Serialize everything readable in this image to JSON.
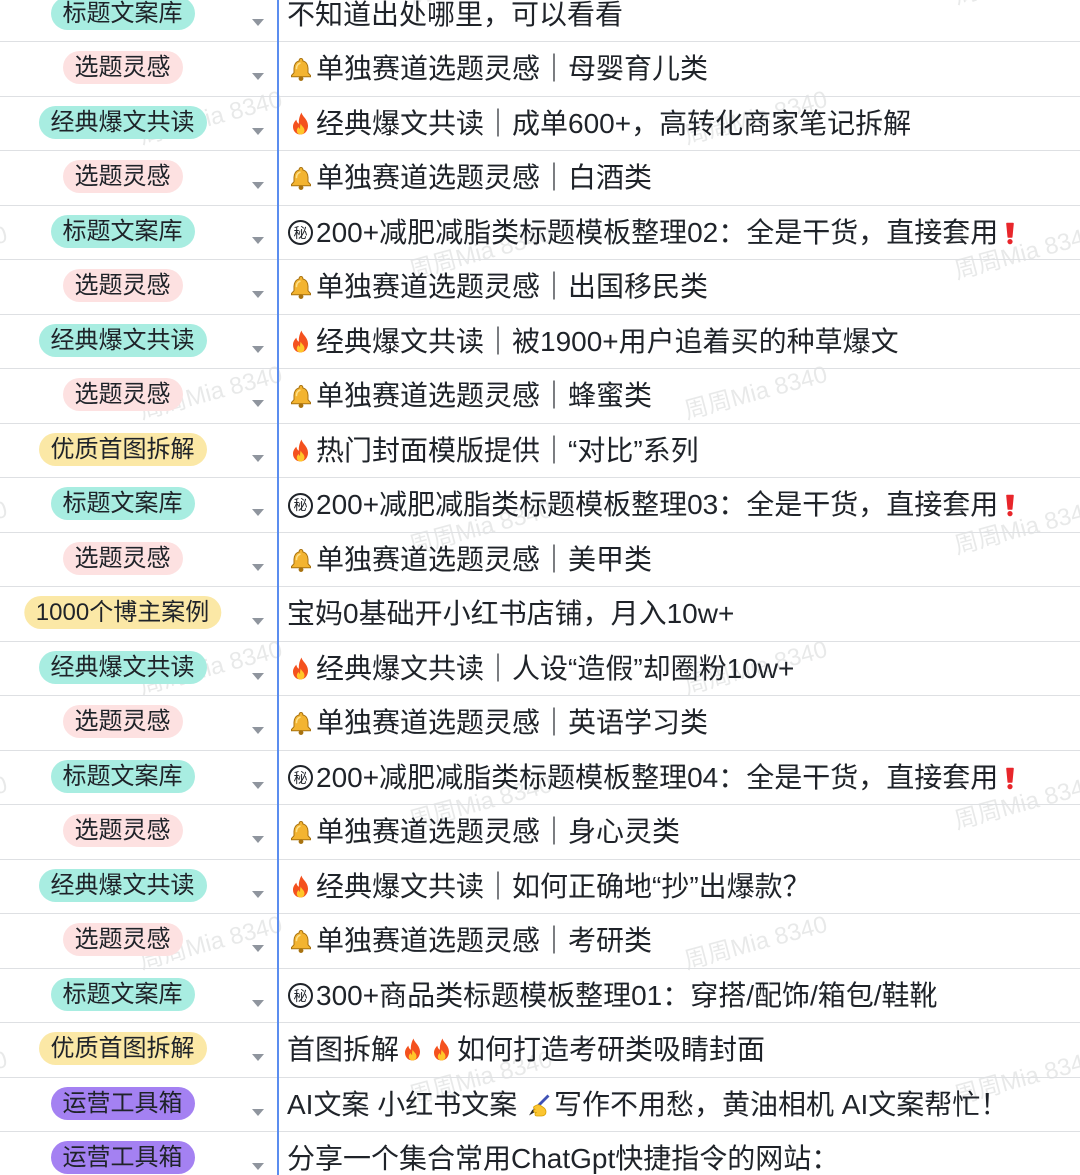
{
  "colors": {
    "text": "#1f2329",
    "row_border": "#dee0e3",
    "column_divider": "#5b8def",
    "arrow": "#8f959e",
    "watermark": "rgba(31,35,41,0.10)"
  },
  "tag_colors": {
    "标题文案库": "#a8ede1",
    "选题灵感": "#fde1e1",
    "经典爆文共读": "#a8ede1",
    "优质首图拆解": "#fbe8a6",
    "1000个博主案例": "#fbe8a6",
    "运营工具箱": "#a481f2"
  },
  "icon_glyphs": {
    "secret": "秘"
  },
  "watermark": {
    "text": "周周Mia 8340"
  },
  "table": {
    "rows": [
      {
        "tag": "标题文案库",
        "segments": [
          {
            "text": "不知道出处哪里，可以看看"
          }
        ]
      },
      {
        "tag": "选题灵感",
        "segments": [
          {
            "icon": "bell-icon"
          },
          {
            "text": "单独赛道选题灵感｜母婴育儿类"
          }
        ]
      },
      {
        "tag": "经典爆文共读",
        "segments": [
          {
            "icon": "fire-icon"
          },
          {
            "text": "经典爆文共读｜成单600+，高转化商家笔记拆解"
          }
        ]
      },
      {
        "tag": "选题灵感",
        "segments": [
          {
            "icon": "bell-icon"
          },
          {
            "text": "单独赛道选题灵感｜白酒类"
          }
        ]
      },
      {
        "tag": "标题文案库",
        "segments": [
          {
            "icon": "secret-icon"
          },
          {
            "text": "200+减肥减脂类标题模板整理02：全是干货，直接套用"
          },
          {
            "icon": "exclamation-icon"
          }
        ]
      },
      {
        "tag": "选题灵感",
        "segments": [
          {
            "icon": "bell-icon"
          },
          {
            "text": "单独赛道选题灵感｜出国移民类"
          }
        ]
      },
      {
        "tag": "经典爆文共读",
        "segments": [
          {
            "icon": "fire-icon"
          },
          {
            "text": "经典爆文共读｜被1900+用户追着买的种草爆文"
          }
        ]
      },
      {
        "tag": "选题灵感",
        "segments": [
          {
            "icon": "bell-icon"
          },
          {
            "text": "单独赛道选题灵感｜蜂蜜类"
          }
        ]
      },
      {
        "tag": "优质首图拆解",
        "segments": [
          {
            "icon": "fire-icon"
          },
          {
            "text": "热门封面模版提供｜“对比”系列"
          }
        ]
      },
      {
        "tag": "标题文案库",
        "segments": [
          {
            "icon": "secret-icon"
          },
          {
            "text": "200+减肥减脂类标题模板整理03：全是干货，直接套用"
          },
          {
            "icon": "exclamation-icon"
          }
        ]
      },
      {
        "tag": "选题灵感",
        "segments": [
          {
            "icon": "bell-icon"
          },
          {
            "text": "单独赛道选题灵感｜美甲类"
          }
        ]
      },
      {
        "tag": "1000个博主案例",
        "segments": [
          {
            "text": "宝妈0基础开小红书店铺，月入10w+"
          }
        ]
      },
      {
        "tag": "经典爆文共读",
        "segments": [
          {
            "icon": "fire-icon"
          },
          {
            "text": "经典爆文共读｜人设“造假”却圈粉10w+"
          }
        ]
      },
      {
        "tag": "选题灵感",
        "segments": [
          {
            "icon": "bell-icon"
          },
          {
            "text": "单独赛道选题灵感｜英语学习类"
          }
        ]
      },
      {
        "tag": "标题文案库",
        "segments": [
          {
            "icon": "secret-icon"
          },
          {
            "text": "200+减肥减脂类标题模板整理04：全是干货，直接套用"
          },
          {
            "icon": "exclamation-icon"
          }
        ]
      },
      {
        "tag": "选题灵感",
        "segments": [
          {
            "icon": "bell-icon"
          },
          {
            "text": "单独赛道选题灵感｜身心灵类"
          }
        ]
      },
      {
        "tag": "经典爆文共读",
        "segments": [
          {
            "icon": "fire-icon"
          },
          {
            "text": "经典爆文共读｜如何正确地“抄”出爆款？"
          }
        ]
      },
      {
        "tag": "选题灵感",
        "segments": [
          {
            "icon": "bell-icon"
          },
          {
            "text": "单独赛道选题灵感｜考研类"
          }
        ]
      },
      {
        "tag": "标题文案库",
        "segments": [
          {
            "icon": "secret-icon"
          },
          {
            "text": "300+商品类标题模板整理01：穿搭/配饰/箱包/鞋靴"
          }
        ]
      },
      {
        "tag": "优质首图拆解",
        "segments": [
          {
            "text": "首图拆解"
          },
          {
            "icon": "fire-icon"
          },
          {
            "icon": "fire-icon"
          },
          {
            "text": "如何打造考研类吸睛封面"
          }
        ]
      },
      {
        "tag": "运营工具箱",
        "segments": [
          {
            "text": "AI文案 小红书文案 "
          },
          {
            "icon": "writing-hand-icon"
          },
          {
            "text": "写作不用愁，黄油相机 AI文案帮忙！"
          }
        ]
      },
      {
        "tag": "运营工具箱",
        "segments": [
          {
            "text": "分享一个集合常用ChatGpt快捷指令的网站："
          }
        ]
      }
    ]
  }
}
